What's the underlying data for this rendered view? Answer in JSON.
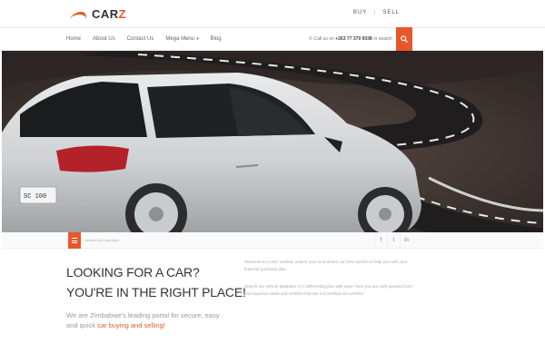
{
  "brand": {
    "name": "CAR",
    "name_accent": "Z"
  },
  "topnav": [
    "BUY",
    "SELL"
  ],
  "nav": {
    "items": [
      "Home",
      "About Us",
      "Contact Us",
      "Mega Menu",
      "Blog"
    ],
    "call_prefix": "Call us on",
    "call_number": "+263 77 379 9038",
    "call_suffix": "or search"
  },
  "strip": {
    "hint": "browse by body style",
    "social": [
      "f",
      "t",
      "in"
    ]
  },
  "headline": {
    "line1": "LOOKING FOR A CAR?",
    "line2": "YOU'RE IN THE RIGHT PLACE!"
  },
  "intro": {
    "lead": "We are Zimbabwe's leading portal for secure, easy and quick ",
    "highlight": "car buying and selling!"
  },
  "paragraphs": {
    "p1": "Welcome to CARZ Verified, search your next dream car here and let us help you with your financial purchase plan.",
    "p2": "Search our vehicle database of a 1000 listing plus with ease, here you are safe guarded from unscrupulous deals and vehicles that are not certified and verified."
  },
  "colors": {
    "accent": "#e8572a"
  },
  "icons": {
    "search": "search-icon",
    "menu": "menu-icon"
  }
}
